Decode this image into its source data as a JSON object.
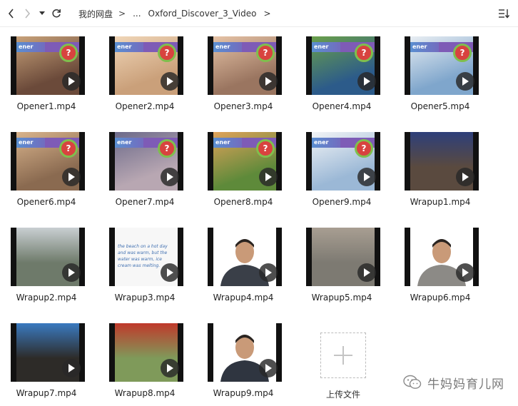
{
  "toolbar": {
    "back_icon": "chevron-left-icon",
    "forward_icon": "chevron-right-icon",
    "history_icon": "dropdown-caret-icon",
    "refresh_icon": "refresh-icon",
    "sort_icon": "sort-icon"
  },
  "breadcrumb": {
    "root": "我的网盘",
    "sep1": ">",
    "ellipsis": "...",
    "current": "Oxford_Discover_3_Video",
    "sep2": ">"
  },
  "files": [
    {
      "name": "Opener1.mp4",
      "kind": "opener",
      "bg": "#6b4a3a",
      "accent": "#c8a27a"
    },
    {
      "name": "Opener2.mp4",
      "kind": "opener",
      "bg": "#caa07a",
      "accent": "#f0d6b8"
    },
    {
      "name": "Opener3.mp4",
      "kind": "opener",
      "bg": "#9a7560",
      "accent": "#e6c3a6"
    },
    {
      "name": "Opener4.mp4",
      "kind": "opener",
      "bg": "#2c5b8a",
      "accent": "#6aa04a"
    },
    {
      "name": "Opener5.mp4",
      "kind": "opener",
      "bg": "#7fa6cc",
      "accent": "#e9eef3"
    },
    {
      "name": "Opener6.mp4",
      "kind": "opener",
      "bg": "#8a6a50",
      "accent": "#d8b38c"
    },
    {
      "name": "Opener7.mp4",
      "kind": "opener",
      "bg": "#b8a7b2",
      "accent": "#6c6a8a"
    },
    {
      "name": "Opener8.mp4",
      "kind": "opener",
      "bg": "#5e8a3a",
      "accent": "#e0a25a"
    },
    {
      "name": "Opener9.mp4",
      "kind": "opener",
      "bg": "#9bb8d6",
      "accent": "#f2f4f6"
    },
    {
      "name": "Wrapup1.mp4",
      "kind": "scene",
      "bg": "#5a4a3f",
      "accent": "#2e3f7a"
    },
    {
      "name": "Wrapup2.mp4",
      "kind": "scene",
      "bg": "#6e7a6a",
      "accent": "#c9cfd2"
    },
    {
      "name": "Wrapup3.mp4",
      "kind": "note",
      "bg": "#f7f7f7",
      "accent": "#3f6fb0"
    },
    {
      "name": "Wrapup4.mp4",
      "kind": "person",
      "bg": "#ffffff",
      "accent": "#3a3f48"
    },
    {
      "name": "Wrapup5.mp4",
      "kind": "scene",
      "bg": "#7d7a72",
      "accent": "#a89e92"
    },
    {
      "name": "Wrapup6.mp4",
      "kind": "person",
      "bg": "#ffffff",
      "accent": "#8c8a86"
    },
    {
      "name": "Wrapup7.mp4",
      "kind": "scene",
      "bg": "#2d2b28",
      "accent": "#3a7ac0"
    },
    {
      "name": "Wrapup8.mp4",
      "kind": "scene",
      "bg": "#7f9a5a",
      "accent": "#c0392b"
    },
    {
      "name": "Wrapup9.mp4",
      "kind": "person",
      "bg": "#ffffff",
      "accent": "#2f3540"
    }
  ],
  "opener_banner": "ener",
  "opener_question": "?",
  "note_text": "the beach on a hot day and was warm, but the water was warm, ice cream was melting.",
  "upload": {
    "label": "上传文件",
    "icon": "plus-icon"
  },
  "watermark": {
    "text": "牛妈妈育儿网",
    "icon": "wechat-icon"
  },
  "play_icon": "play-icon"
}
